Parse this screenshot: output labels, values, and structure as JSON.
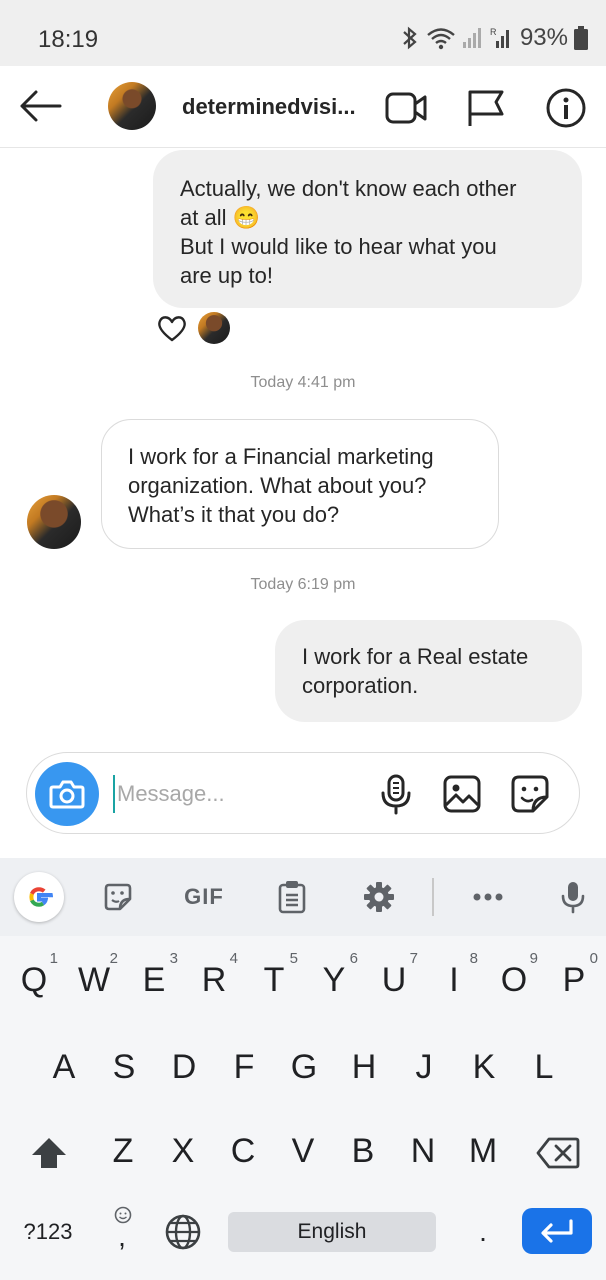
{
  "status_bar": {
    "time": "18:19",
    "battery": "93%",
    "icons": [
      "bluetooth-icon",
      "wifi-icon",
      "signal-icon",
      "signal-roaming-icon",
      "battery-icon"
    ]
  },
  "header": {
    "username": "determinedvisi...",
    "icons": [
      "back-arrow-icon",
      "video-call-icon",
      "flag-icon",
      "info-icon"
    ]
  },
  "messages": [
    {
      "direction": "outgoing",
      "lines": [
        "Actually, we don't know each other",
        "at all 😁",
        "But I would like to hear what you",
        "are up to!"
      ],
      "reaction": "heart-icon"
    },
    {
      "type": "timestamp",
      "text": "Today 4:41 pm"
    },
    {
      "direction": "incoming",
      "lines": [
        "I work for a Financial marketing",
        "organization. What about you?",
        "What’s it that you do?"
      ]
    },
    {
      "type": "timestamp",
      "text": "Today 6:19 pm"
    },
    {
      "direction": "outgoing",
      "lines": [
        "I work for a Real estate",
        "corporation."
      ]
    }
  ],
  "composer": {
    "placeholder": "Message...",
    "icons": [
      "camera-icon",
      "microphone-icon",
      "gallery-icon",
      "sticker-icon"
    ]
  },
  "keyboard": {
    "toolbar": [
      "google-icon",
      "sticker-icon",
      "GIF",
      "clipboard-icon",
      "settings-icon",
      "more-icon",
      "mic-icon"
    ],
    "gif_label": "GIF",
    "row1": [
      {
        "k": "Q",
        "h": "1"
      },
      {
        "k": "W",
        "h": "2"
      },
      {
        "k": "E",
        "h": "3"
      },
      {
        "k": "R",
        "h": "4"
      },
      {
        "k": "T",
        "h": "5"
      },
      {
        "k": "Y",
        "h": "6"
      },
      {
        "k": "U",
        "h": "7"
      },
      {
        "k": "I",
        "h": "8"
      },
      {
        "k": "O",
        "h": "9"
      },
      {
        "k": "P",
        "h": "0"
      }
    ],
    "row2": [
      "A",
      "S",
      "D",
      "F",
      "G",
      "H",
      "J",
      "K",
      "L"
    ],
    "row3": [
      "Z",
      "X",
      "C",
      "V",
      "B",
      "N",
      "M"
    ],
    "symbols_label": "?123",
    "comma": ",",
    "period": ".",
    "space_label": "English",
    "accent_color": "#1a73e8"
  }
}
